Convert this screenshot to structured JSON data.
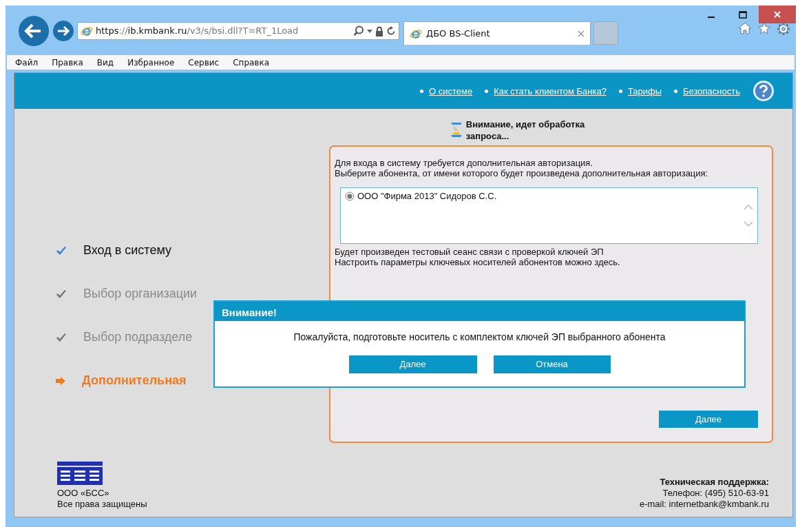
{
  "browser": {
    "address": "**https**://**ib.kmbank.ru**/v3/s/bsi.dll?T=RT_1Load",
    "tabs": [
      {
        "label": "ДБО BS-Client",
        "selected": true
      }
    ],
    "menu": [
      "Файл",
      "Правка",
      "Вид",
      "Избранное",
      "Сервис",
      "Справка"
    ]
  },
  "nav_links": [
    "О системе",
    "Как стать клиентом Банка?",
    "Тарифы",
    "Безопасность"
  ],
  "status_message": "Внимание, идет обработка запроса...",
  "steps": [
    {
      "label": "Вход в систему",
      "kind": "done"
    },
    {
      "label": "Выбор организации",
      "kind": "passed"
    },
    {
      "label": "Выбор подразделе",
      "kind": "passed"
    },
    {
      "label": "Дополнительная",
      "kind": "current"
    }
  ],
  "auth": {
    "intro": "Для входа в систему требуется дополнительная авторизация.",
    "prompt": "Выберите абонента, от имени которого будет произведена дополнительная авторизация:",
    "subscribers": [
      {
        "label": "ООО \"Фирма 2013\" Сидоров С.С.",
        "selected": true
      }
    ],
    "note": "Будет произведен тестовый сеанс связи с проверкой ключей ЭП",
    "settings": {
      "before": "Настроить параметры ключевых носителей абонентов можно ",
      "link": "здесь",
      "after": "."
    },
    "next_button": "Далее"
  },
  "dialog": {
    "title": "Внимание!",
    "message": "Пожалуйста, подготовьте носитель с комплектом ключей ЭП выбранного абонента",
    "buttons": [
      "Далее",
      "Отмена"
    ]
  },
  "footer": {
    "company": "ООО «БСС»",
    "rights": "Все права защищены",
    "support_title": "Техническая поддержка:",
    "phone": "Телефон: (495) 510-63-91",
    "email_label": "e-mail: ",
    "email": "internetbank@kmbank.ru"
  }
}
